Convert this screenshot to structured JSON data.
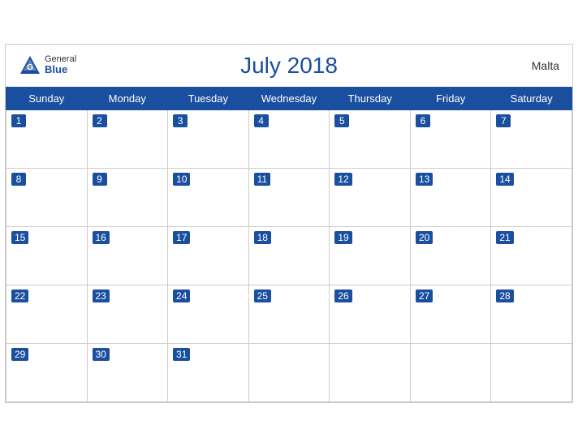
{
  "header": {
    "title": "July 2018",
    "country": "Malta",
    "logo": {
      "general": "General",
      "blue": "Blue"
    }
  },
  "weekdays": [
    "Sunday",
    "Monday",
    "Tuesday",
    "Wednesday",
    "Thursday",
    "Friday",
    "Saturday"
  ],
  "weeks": [
    [
      1,
      2,
      3,
      4,
      5,
      6,
      7
    ],
    [
      8,
      9,
      10,
      11,
      12,
      13,
      14
    ],
    [
      15,
      16,
      17,
      18,
      19,
      20,
      21
    ],
    [
      22,
      23,
      24,
      25,
      26,
      27,
      28
    ],
    [
      29,
      30,
      31,
      null,
      null,
      null,
      null
    ]
  ]
}
